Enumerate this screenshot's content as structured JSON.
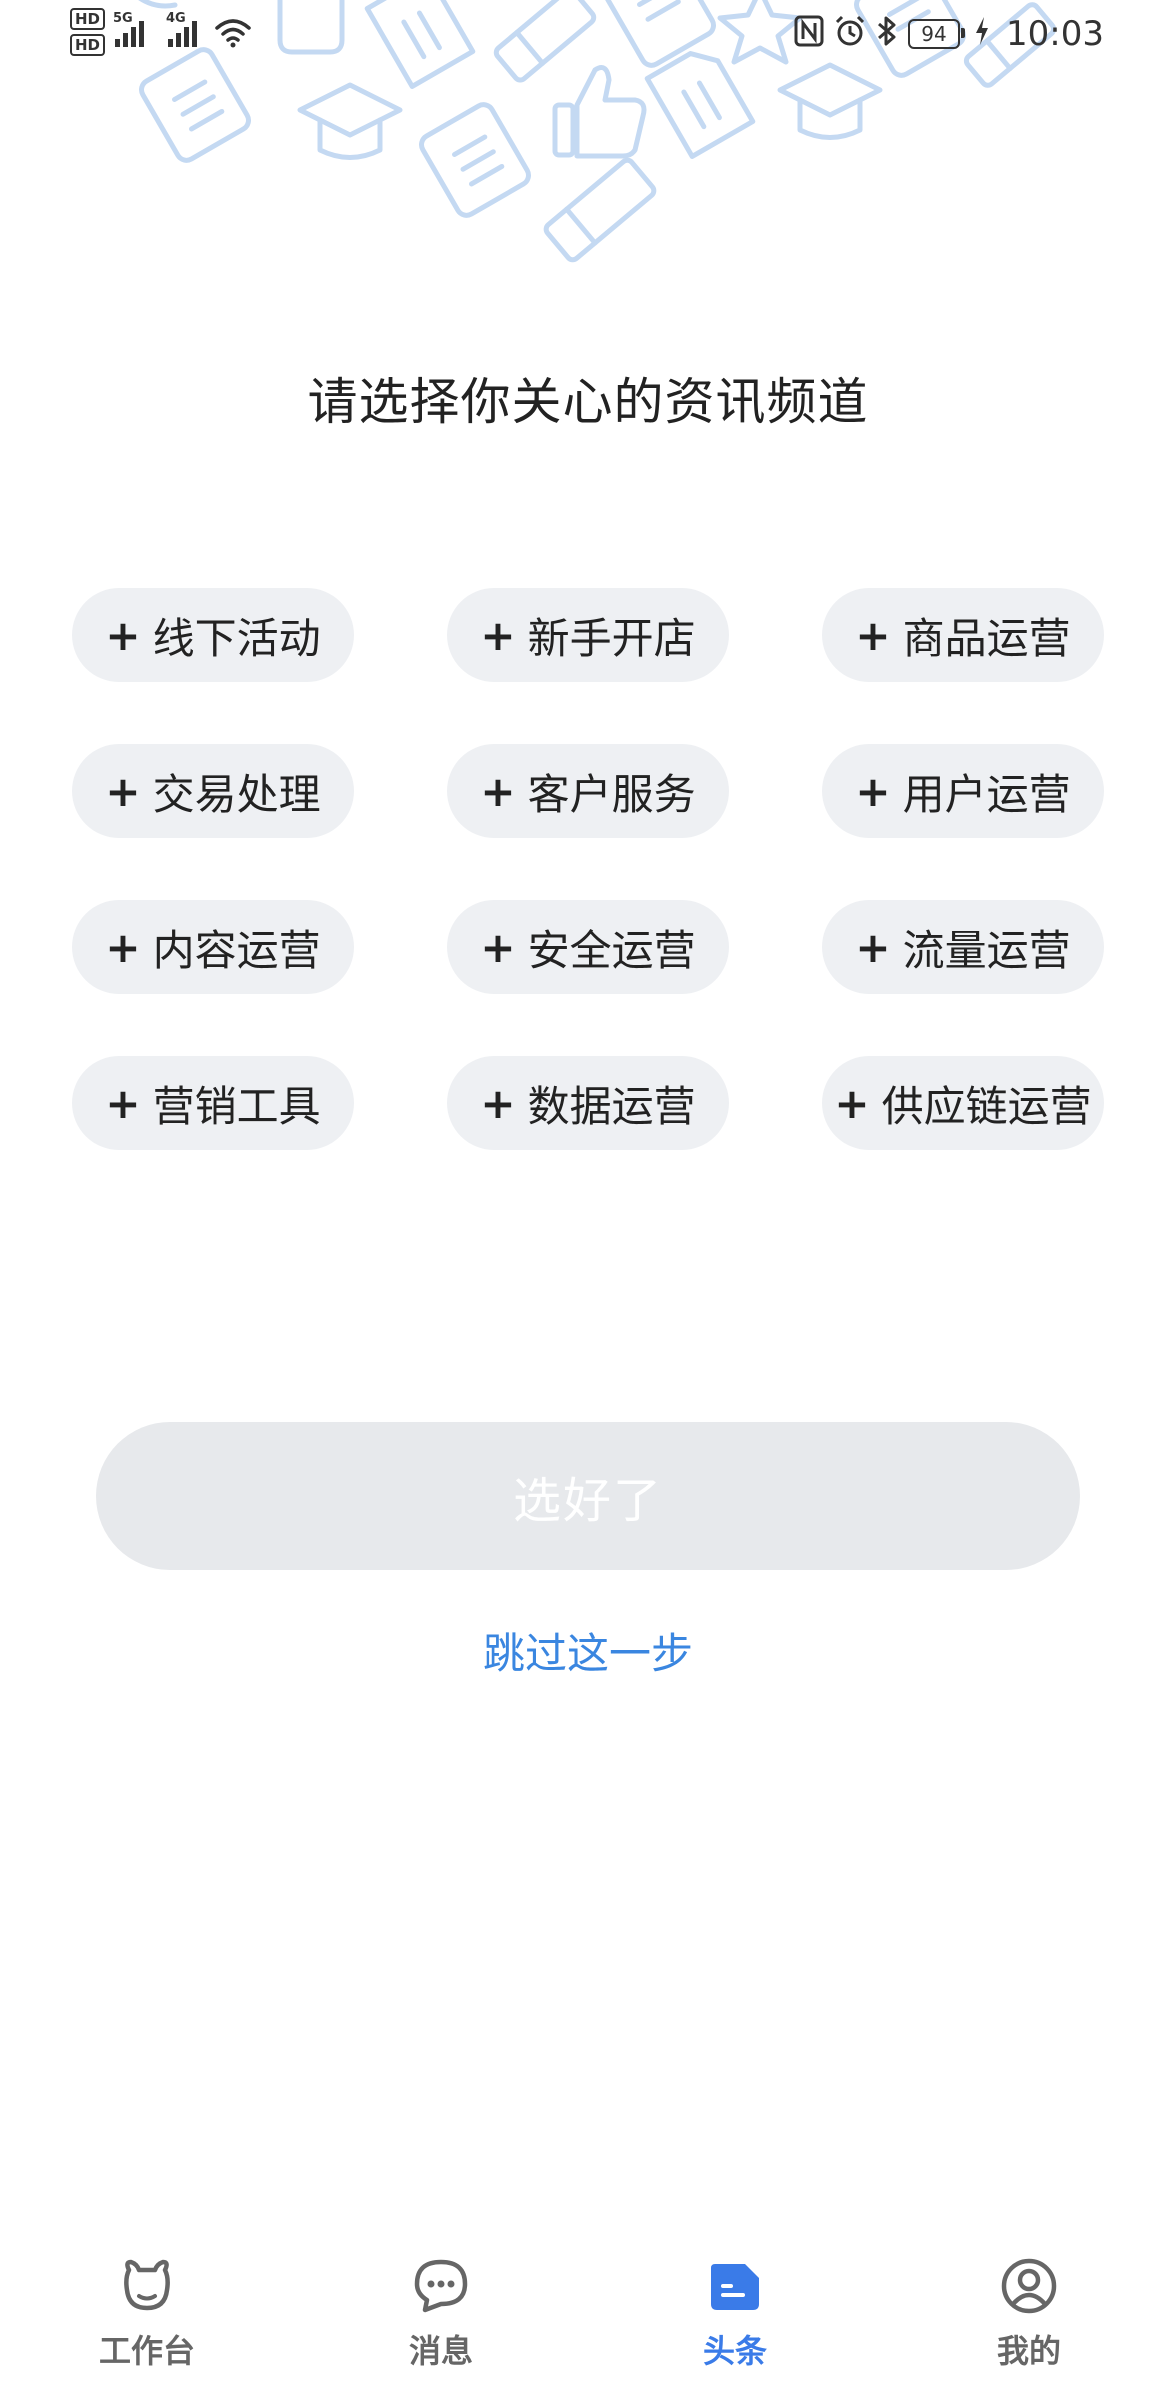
{
  "status_bar": {
    "hd1": "HD",
    "hd2": "HD",
    "net1": "5G",
    "net2": "4G",
    "battery": "94",
    "time": "10:03"
  },
  "title": "请选择你关心的资讯频道",
  "chips": [
    {
      "label": "线下活动"
    },
    {
      "label": "新手开店"
    },
    {
      "label": "商品运营"
    },
    {
      "label": "交易处理"
    },
    {
      "label": "客户服务"
    },
    {
      "label": "用户运营"
    },
    {
      "label": "内容运营"
    },
    {
      "label": "安全运营"
    },
    {
      "label": "流量运营"
    },
    {
      "label": "营销工具"
    },
    {
      "label": "数据运营"
    },
    {
      "label": "供应链运营"
    }
  ],
  "chip_plus": "+",
  "confirm_label": "选好了",
  "skip_label": "跳过这一步",
  "nav": {
    "items": [
      {
        "label": "工作台",
        "icon": "bull-icon"
      },
      {
        "label": "消息",
        "icon": "chat-bubble-icon"
      },
      {
        "label": "头条",
        "icon": "headline-icon",
        "active": true
      },
      {
        "label": "我的",
        "icon": "user-circle-icon"
      }
    ]
  },
  "colors": {
    "accent": "#3a7be8",
    "link": "#3a86e0",
    "chip_bg": "#eef0f3",
    "deco_stroke": "#c4d9f2"
  }
}
